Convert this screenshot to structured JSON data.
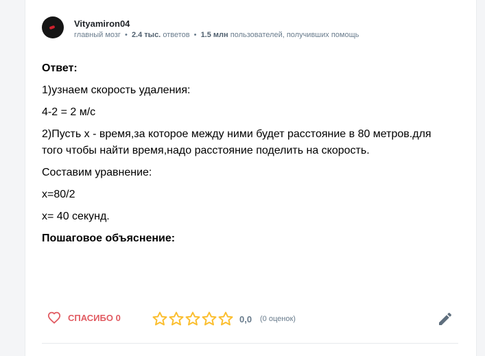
{
  "author": {
    "username": "Vityamiron04",
    "rank": "главный мозг",
    "answers_count": "2.4 тыс.",
    "answers_label": "ответов",
    "helped_count": "1.5 млн",
    "helped_label": "пользователей, получивших помощь"
  },
  "answer": {
    "heading": "Ответ:",
    "lines": [
      "1)узнаем скорость удаления:",
      "4-2 = 2 м/с",
      "2)Пусть х - время,за которое между ними будет расстояние в 80 метров.для того чтобы найти время,надо расстояние поделить на скорость.",
      "Составим уравнение:",
      "х=80/2",
      "х= 40 секунд."
    ],
    "explanation_heading": "Пошаговое объяснение:"
  },
  "footer": {
    "thanks_label": "СПАСИБО 0",
    "rating_value": "0,0",
    "rating_count": "(0 оценок)",
    "rating_stars_filled": 0,
    "rating_stars_total": 5
  },
  "colors": {
    "accent": "#e15b62",
    "star": "#fbbe2e",
    "muted": "#687b8c"
  },
  "icons": [
    "heart-icon",
    "star-icon",
    "pencil-icon"
  ]
}
